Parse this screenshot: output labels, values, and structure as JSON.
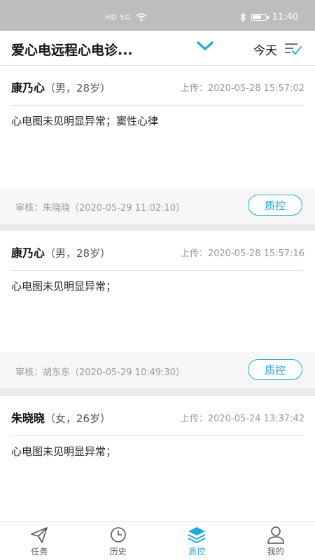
{
  "status_bar": {
    "network_left": "HD 5G",
    "time": "11:40"
  },
  "header": {
    "title": "爱心电远程心电诊...",
    "date_filter": "今天"
  },
  "cards": [
    {
      "name": "康乃心",
      "meta": "（男，28岁）",
      "upload": "上传：2020-05-28 15:57:02",
      "diagnosis": "心电图未见明显异常；窦性心律",
      "review": "审核：朱晓晓（2020-05-29 11:02:10）",
      "button": "质控"
    },
    {
      "name": "康乃心",
      "meta": "（男，28岁）",
      "upload": "上传：2020-05-28 15:57:16",
      "diagnosis": "心电图未见明显异常；",
      "review": "审核：胡东东（2020-05-29 10:49:30）",
      "button": "质控"
    },
    {
      "name": "朱晓晓",
      "meta": "（女，26岁）",
      "upload": "上传：2020-05-24 13:37:42",
      "diagnosis": "心电图未见明显异常；",
      "review": "",
      "button": ""
    }
  ],
  "tabs": [
    {
      "label": "任务",
      "icon": "send-icon",
      "active": false
    },
    {
      "label": "历史",
      "icon": "clock-icon",
      "active": false
    },
    {
      "label": "质控",
      "icon": "layers-icon",
      "active": true
    },
    {
      "label": "我的",
      "icon": "user-icon",
      "active": false
    }
  ],
  "colors": {
    "accent": "#1fa8d8",
    "statusbar": "#bdbdbd"
  }
}
